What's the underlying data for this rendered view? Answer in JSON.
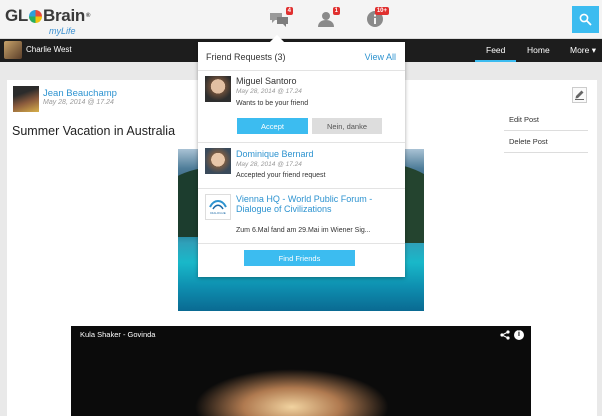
{
  "logo": {
    "main_left": "GL",
    "main_right": "Brain",
    "registered": "®",
    "sub": "myLife"
  },
  "notifications": [
    {
      "icon": "chat-bubbles-icon",
      "count": "4"
    },
    {
      "icon": "friends-icon",
      "count": "1"
    },
    {
      "icon": "info-icon",
      "count": "10+"
    }
  ],
  "search": {
    "icon": "search-icon"
  },
  "user": {
    "name": "Charlie West"
  },
  "nav": {
    "feed": "Feed",
    "home": "Home",
    "more": "More ▾"
  },
  "post": {
    "author": "Jean Beauchamp",
    "time": "May 28, 2014 @ 17.24",
    "title": "Summer Vacation in Australia",
    "menu": [
      "Edit Post",
      "Delete Post"
    ],
    "video": {
      "title": "Kula Shaker - Govinda",
      "share": "<",
      "info": "i"
    }
  },
  "friend_requests": {
    "title": "Friend Requests (3)",
    "view_all": "View All",
    "items": [
      {
        "name": "Miguel Santoro",
        "time": "May 28, 2014 @ 17.24",
        "message": "Wants to be your friend",
        "accept": "Accept",
        "decline": "Nein, danke"
      },
      {
        "name": "Dominique Bernard",
        "time": "May 28, 2014 @ 17.24",
        "message": "Accepted your friend request"
      },
      {
        "name_line1": "Vienna HQ - World Public Forum -",
        "name_line2": "Dialogue of Civilizations",
        "logo_text": "DIALOGUE",
        "message": "Zum 6.Mal fand am 29.Mai im Wiener Sig..."
      }
    ],
    "find_friends": "Find Friends"
  },
  "colors": {
    "accent": "#3cbcf0",
    "link": "#2d93d0",
    "badge": "#e0302f",
    "navbar": "#1d1d1d"
  }
}
